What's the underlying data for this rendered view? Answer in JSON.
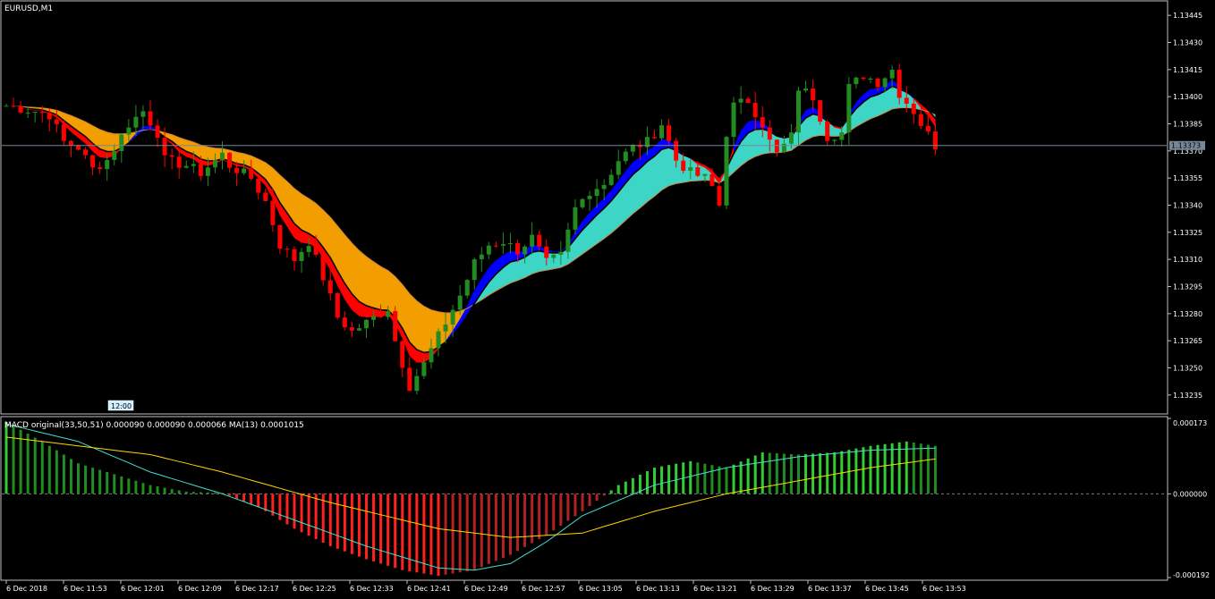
{
  "window_title": "EURUSD,M1",
  "time_marker": "12:00",
  "macd_label": "MACD original(33,50,51) 0.000090 0.000090 0.000066 MA(13) 0.0001015",
  "current_price": "1.13373",
  "colors": {
    "background": "#000000",
    "bull_candle": "#228b22",
    "bear_candle": "#ff0000",
    "cloud_down": "#ffa500",
    "cloud_up": "#40e0d0",
    "band_down": "#ff0000",
    "band_up": "#0000ff",
    "macd_signal": "#40e0d0",
    "macd_ma": "#ffd700",
    "hist_pos": "#32cd32",
    "hist_neg": "#ff2020"
  },
  "chart_data": [
    {
      "type": "candlestick",
      "title": "EURUSD,M1",
      "ylim": [
        1.13226,
        1.13452
      ],
      "y_ticks": [
        "1.13445",
        "1.13430",
        "1.13415",
        "1.13400",
        "1.13385",
        "1.13370",
        "1.13355",
        "1.13340",
        "1.13325",
        "1.13310",
        "1.13295",
        "1.13280",
        "1.13265",
        "1.13250",
        "1.13235"
      ],
      "x_ticks": [
        "6 Dec 2018",
        "6 Dec 11:53",
        "6 Dec 12:01",
        "6 Dec 12:09",
        "6 Dec 12:17",
        "6 Dec 12:25",
        "6 Dec 12:33",
        "6 Dec 12:41",
        "6 Dec 12:49",
        "6 Dec 12:57",
        "6 Dec 13:05",
        "6 Dec 13:13",
        "6 Dec 13:21",
        "6 Dec 13:29",
        "6 Dec 13:37",
        "6 Dec 13:45",
        "6 Dec 13:53"
      ],
      "current_price": 1.13373,
      "close_path": [
        [
          0,
          1.13395
        ],
        [
          4,
          1.13392
        ],
        [
          6,
          1.1339
        ],
        [
          8,
          1.13375
        ],
        [
          10,
          1.13372
        ],
        [
          12,
          1.1336
        ],
        [
          14,
          1.13365
        ],
        [
          16,
          1.13378
        ],
        [
          17,
          1.13385
        ],
        [
          19,
          1.13392
        ],
        [
          21,
          1.1338
        ],
        [
          22,
          1.13365
        ],
        [
          25,
          1.13362
        ],
        [
          27,
          1.13358
        ],
        [
          30,
          1.13368
        ],
        [
          31,
          1.13362
        ],
        [
          34,
          1.13355
        ],
        [
          36,
          1.13342
        ],
        [
          38,
          1.13318
        ],
        [
          40,
          1.1331
        ],
        [
          42,
          1.1332
        ],
        [
          44,
          1.133
        ],
        [
          46,
          1.13278
        ],
        [
          48,
          1.1327
        ],
        [
          50,
          1.13275
        ],
        [
          53,
          1.13283
        ],
        [
          54,
          1.13265
        ],
        [
          56,
          1.1324
        ],
        [
          58,
          1.13252
        ],
        [
          59,
          1.1326
        ],
        [
          61,
          1.13275
        ],
        [
          63,
          1.1329
        ],
        [
          65,
          1.13308
        ],
        [
          67,
          1.13318
        ],
        [
          69,
          1.1332
        ],
        [
          71,
          1.13315
        ],
        [
          73,
          1.13322
        ],
        [
          75,
          1.13308
        ],
        [
          77,
          1.13312
        ],
        [
          79,
          1.13338
        ],
        [
          81,
          1.13348
        ],
        [
          83,
          1.13352
        ],
        [
          85,
          1.13365
        ],
        [
          87,
          1.13372
        ],
        [
          89,
          1.13375
        ],
        [
          91,
          1.13385
        ],
        [
          93,
          1.13365
        ],
        [
          95,
          1.13358
        ],
        [
          97,
          1.13355
        ],
        [
          98,
          1.1335
        ],
        [
          99,
          1.1334
        ],
        [
          100,
          1.1338
        ],
        [
          101,
          1.13395
        ],
        [
          103,
          1.13398
        ],
        [
          105,
          1.13385
        ],
        [
          106,
          1.13375
        ],
        [
          107,
          1.13368
        ],
        [
          109,
          1.13378
        ],
        [
          110,
          1.13405
        ],
        [
          112,
          1.134
        ],
        [
          114,
          1.13378
        ],
        [
          116,
          1.1338
        ],
        [
          117,
          1.13405
        ],
        [
          119,
          1.13412
        ],
        [
          121,
          1.13408
        ],
        [
          123,
          1.13415
        ],
        [
          124,
          1.13402
        ],
        [
          126,
          1.13392
        ],
        [
          127,
          1.13385
        ],
        [
          129,
          1.13373
        ]
      ],
      "volatility": 0.00012
    },
    {
      "type": "macd_histogram",
      "title": "MACD original(33,50,51) 0.000090 0.000090 0.000066 MA(13) 0.0001015",
      "ylim": [
        -0.000192,
        0.000173
      ],
      "y_ticks": [
        "0.000173",
        "0.000000",
        "-0.000192"
      ],
      "hist_path": [
        [
          0,
          0.000165
        ],
        [
          5,
          0.00012
        ],
        [
          10,
          7e-05
        ],
        [
          15,
          4.5e-05
        ],
        [
          20,
          2e-05
        ],
        [
          25,
          5e-06
        ],
        [
          30,
          2e-06
        ],
        [
          35,
          -3e-05
        ],
        [
          40,
          -8e-05
        ],
        [
          45,
          -0.00012
        ],
        [
          50,
          -0.00015
        ],
        [
          55,
          -0.000175
        ],
        [
          60,
          -0.000188
        ],
        [
          65,
          -0.000175
        ],
        [
          70,
          -0.00014
        ],
        [
          75,
          -9.5e-05
        ],
        [
          80,
          -4e-05
        ],
        [
          85,
          2e-05
        ],
        [
          90,
          6e-05
        ],
        [
          95,
          7.5e-05
        ],
        [
          100,
          6e-05
        ],
        [
          105,
          9.5e-05
        ],
        [
          110,
          9e-05
        ],
        [
          115,
          9.5e-05
        ],
        [
          120,
          0.00011
        ],
        [
          125,
          0.00012
        ],
        [
          129,
          0.00011
        ]
      ],
      "signal_path": [
        [
          0,
          0.00016
        ],
        [
          10,
          0.00012
        ],
        [
          20,
          5e-05
        ],
        [
          30,
          0.0
        ],
        [
          40,
          -6e-05
        ],
        [
          50,
          -0.00012
        ],
        [
          60,
          -0.00017
        ],
        [
          65,
          -0.000175
        ],
        [
          70,
          -0.00016
        ],
        [
          75,
          -0.00011
        ],
        [
          80,
          -5e-05
        ],
        [
          90,
          2e-05
        ],
        [
          100,
          6e-05
        ],
        [
          110,
          8.5e-05
        ],
        [
          120,
          0.0001
        ],
        [
          129,
          0.000105
        ]
      ],
      "ma_path": [
        [
          0,
          0.00013
        ],
        [
          20,
          9e-05
        ],
        [
          30,
          5e-05
        ],
        [
          45,
          -2e-05
        ],
        [
          60,
          -8e-05
        ],
        [
          70,
          -0.0001
        ],
        [
          80,
          -9e-05
        ],
        [
          90,
          -4e-05
        ],
        [
          100,
          0.0
        ],
        [
          110,
          3e-05
        ],
        [
          120,
          6e-05
        ],
        [
          129,
          8e-05
        ]
      ]
    }
  ]
}
